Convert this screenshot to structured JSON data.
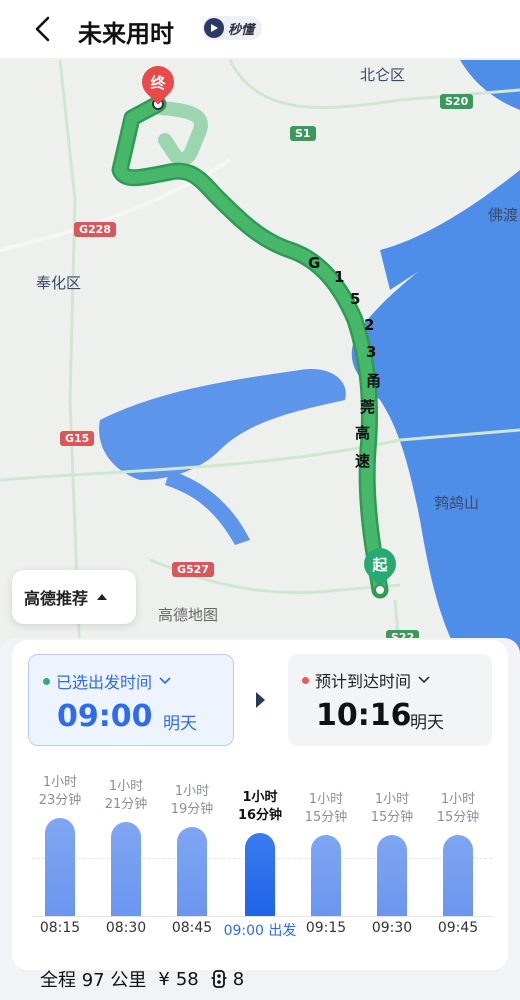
{
  "header": {
    "title": "未来用时",
    "badge": "秒懂"
  },
  "map": {
    "labels": {
      "beilun": "北仑区",
      "fenghua": "奉化区",
      "fodu": "佛渡",
      "jiegushan": "鹁鸪山",
      "watermark": "高德地图"
    },
    "shields": {
      "s20": "S20",
      "s1": "S1",
      "g228": "G228",
      "g15": "G15",
      "g527": "G527",
      "s22": "S22"
    },
    "route_chars": [
      "G",
      "1",
      "5",
      "2",
      "3",
      "甬",
      "莞",
      "高",
      "速"
    ],
    "end_marker": "终",
    "start_marker": "起",
    "colors": {
      "route": "#3fae63",
      "water": "#4f8ee8",
      "land": "#eef0ee"
    }
  },
  "recommend": {
    "label": "高德推荐"
  },
  "depart": {
    "label": "已选出发时间",
    "time": "09:00",
    "day": "明天"
  },
  "arrive": {
    "label": "预计到达时间",
    "time": "10:16",
    "day": "明天"
  },
  "chart_data": {
    "type": "bar",
    "categories": [
      "08:15",
      "08:30",
      "08:45",
      "09:00 出发",
      "09:15",
      "09:30",
      "09:45"
    ],
    "duration_labels": [
      [
        "1小时",
        "23分钟"
      ],
      [
        "1小时",
        "21分钟"
      ],
      [
        "1小时",
        "19分钟"
      ],
      [
        "1小时",
        "16分钟"
      ],
      [
        "1小时",
        "15分钟"
      ],
      [
        "1小时",
        "15分钟"
      ],
      [
        "1小时",
        "15分钟"
      ]
    ],
    "values": [
      83,
      81,
      79,
      76,
      75,
      75,
      75
    ],
    "selected_index": 3,
    "colors": {
      "bar": "#7fa6f2",
      "selected": "#1e63e8"
    }
  },
  "summary": {
    "distance": "全程 97 公里",
    "toll": "58",
    "lights": "8"
  }
}
